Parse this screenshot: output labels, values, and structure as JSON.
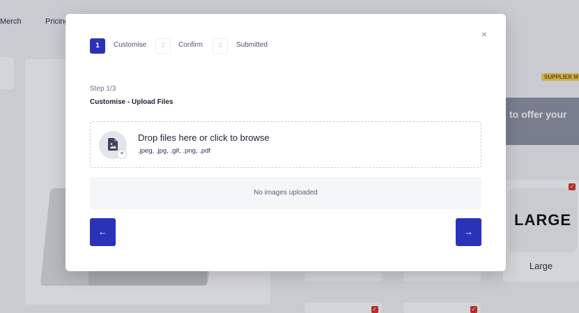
{
  "background": {
    "nav": [
      "Merch",
      "Pricing"
    ],
    "supplier_badge": "SUPPLIER M",
    "promo_text": "to offer your",
    "size_card": {
      "text": "LARGE",
      "label": "Large"
    },
    "checkmark": "✓"
  },
  "modal": {
    "close_icon": "close-icon",
    "close_glyph": "×",
    "steps": [
      {
        "number": "1",
        "label": "Customise",
        "active": true
      },
      {
        "number": "2",
        "label": "Confirm",
        "active": false
      },
      {
        "number": "3",
        "label": "Submitted",
        "active": false
      }
    ],
    "step_indicator": "Step 1/3",
    "step_title": "Customise - Upload Files",
    "dropzone": {
      "title": "Drop files here or click to browse",
      "types": ".jpeg, .jpg, .gif, .png, .pdf",
      "icon": "file-image-icon",
      "plus_glyph": "+"
    },
    "no_images": "No images uploaded",
    "back_glyph": "←",
    "next_glyph": "→",
    "accent_color": "#2a33b8"
  }
}
